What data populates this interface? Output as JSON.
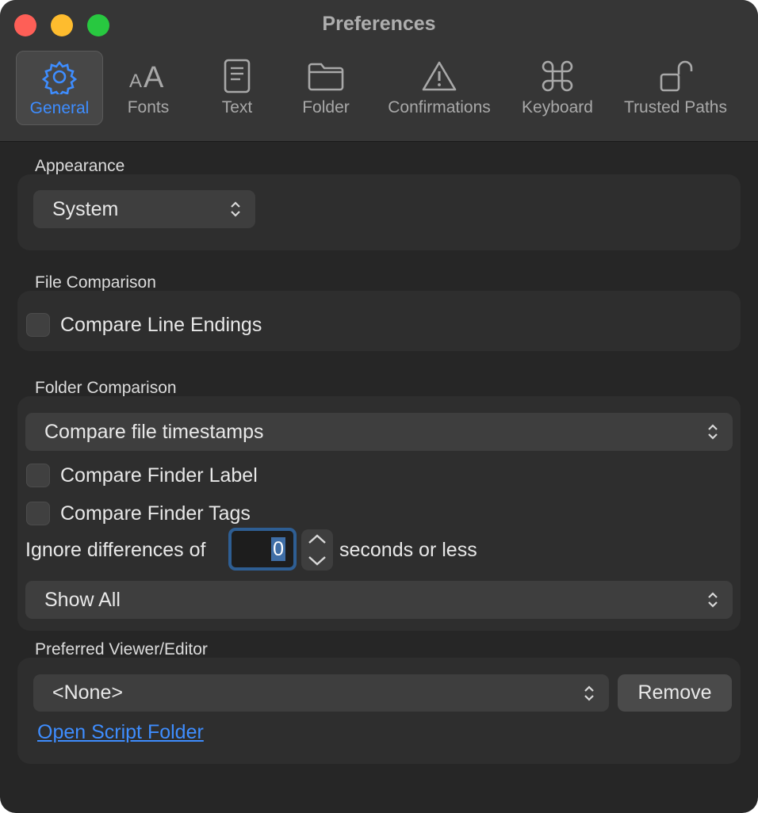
{
  "window": {
    "title": "Preferences"
  },
  "tabs": [
    {
      "label": "General",
      "icon": "gear-icon",
      "active": true
    },
    {
      "label": "Fonts",
      "icon": "fonts-icon"
    },
    {
      "label": "Text",
      "icon": "document-icon"
    },
    {
      "label": "Folder",
      "icon": "folder-icon"
    },
    {
      "label": "Confirmations",
      "icon": "warning-icon"
    },
    {
      "label": "Keyboard",
      "icon": "command-icon"
    },
    {
      "label": "Trusted Paths",
      "icon": "unlocked-icon"
    }
  ],
  "appearance": {
    "label": "Appearance",
    "value": "System"
  },
  "file_comparison": {
    "label": "File Comparison",
    "compare_line_endings": "Compare Line Endings"
  },
  "folder_comparison": {
    "label": "Folder Comparison",
    "method": "Compare file timestamps",
    "finder_label": "Compare Finder Label",
    "finder_tags": "Compare Finder Tags",
    "ignore_prefix": "Ignore differences of",
    "ignore_value": "0",
    "ignore_suffix": "seconds or less",
    "filter": "Show All"
  },
  "viewer": {
    "label": "Preferred Viewer/Editor",
    "value": "<None>",
    "remove_label": "Remove",
    "script_link": "Open Script Folder"
  },
  "colors": {
    "accent": "#3e8dff",
    "window_bg": "#262626",
    "panel_bg": "#2e2e2e"
  }
}
